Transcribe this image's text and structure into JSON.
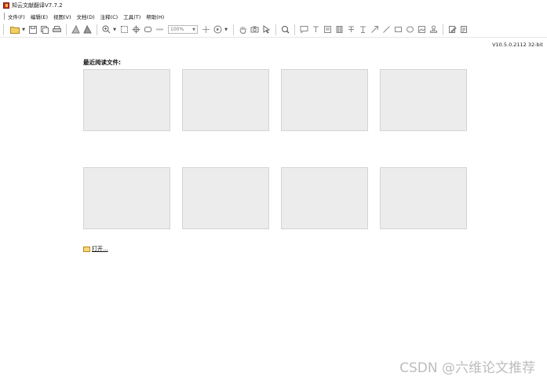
{
  "app": {
    "title": "知云文献翻译V7.7.2"
  },
  "menu": [
    "文件(F)",
    "编辑(E)",
    "视图(V)",
    "文档(D)",
    "注释(C)",
    "工具(T)",
    "帮助(H)"
  ],
  "toolbar": {
    "zoom_value": "100%",
    "icons": [
      "open-folder-icon",
      "dropdown-arrow-icon",
      "save-icon",
      "save-all-icon",
      "print-icon",
      "rotate-left-icon",
      "rotate-right-icon",
      "zoom-in-icon",
      "dropdown-arrow-icon",
      "fit-page-icon",
      "fit-width-icon",
      "fit-visible-icon",
      "page-icon",
      "fit-view-icon",
      "play-icon",
      "dropdown-arrow-icon",
      "hand-tool-icon",
      "snapshot-icon",
      "select-tool-icon",
      "search-icon",
      "comment-icon",
      "text-box-icon",
      "note-icon",
      "highlight-icon",
      "strikeout-icon",
      "insert-text-icon",
      "arrow-icon",
      "line-icon",
      "rectangle-icon",
      "ellipse-icon",
      "image-icon",
      "stamp-icon",
      "edit-icon",
      "form-icon"
    ]
  },
  "version": "V10.5.0.2112 32-bit",
  "recent": {
    "heading": "最近阅读文件:",
    "thumbnails": [
      "",
      "",
      "",
      "",
      "",
      "",
      "",
      ""
    ]
  },
  "open_label": "打开...",
  "watermark": "CSDN @六维论文推荐"
}
